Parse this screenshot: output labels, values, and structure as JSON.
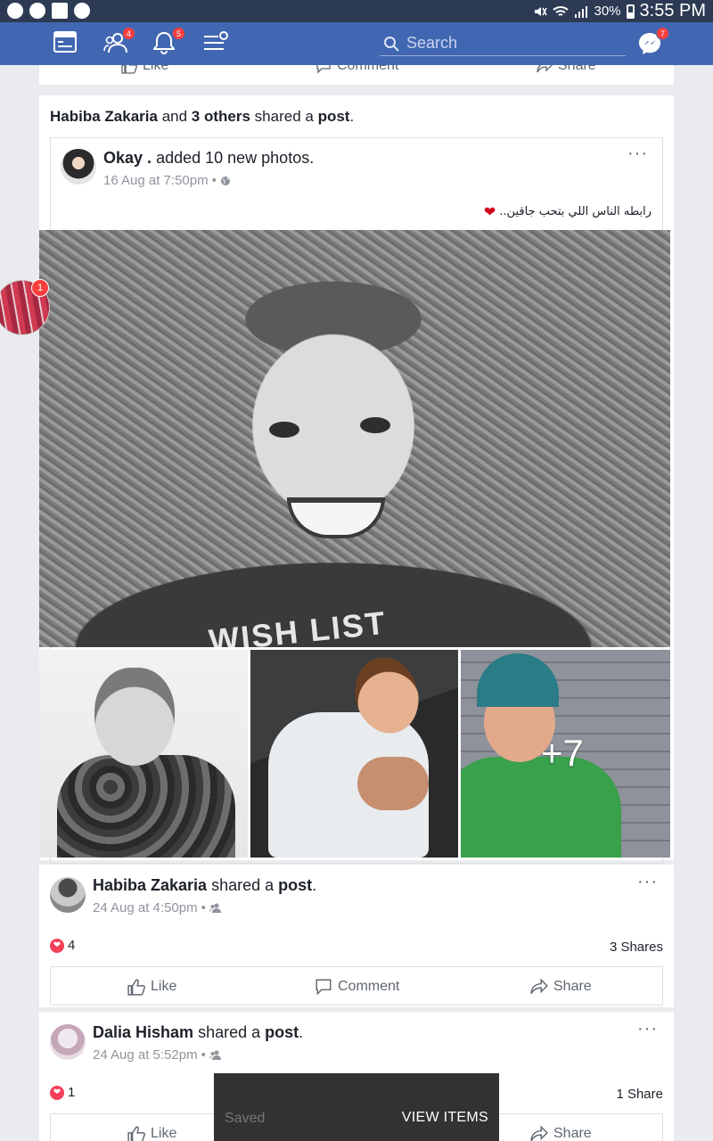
{
  "status": {
    "battery": "30%",
    "time": "3:55 PM"
  },
  "header": {
    "search_placeholder": "Search",
    "friend_requests_badge": "4",
    "notifications_badge": "5",
    "messenger_badge": "7"
  },
  "prev_post_actions": {
    "like": "Like",
    "comment": "Comment",
    "share": "Share"
  },
  "post1": {
    "headline": {
      "actor": "Habiba Zakaria",
      "and": "and",
      "others": "3 others",
      "verb": "shared a",
      "object": "post",
      "period": "."
    },
    "inner": {
      "author": "Okay .",
      "action": "added 10 new photos.",
      "time": "16 Aug at 7:50pm",
      "caption": "رابطه الناس اللي بتحب جاقين..",
      "main_photo_text": "WISH LIST",
      "more_photos": "+7"
    }
  },
  "post2": {
    "author": "Habiba Zakaria",
    "verb": "shared a",
    "object": "post",
    "period": ".",
    "time": "24 Aug at 4:50pm",
    "reactions": "4",
    "shares": "3 Shares",
    "actions": {
      "like": "Like",
      "comment": "Comment",
      "share": "Share"
    }
  },
  "post3": {
    "author": "Dalia Hisham",
    "verb": "shared a",
    "object": "post",
    "period": ".",
    "time": "24 Aug at 5:52pm",
    "reactions": "1",
    "shares": "1 Share",
    "actions": {
      "like": "Like",
      "share": "Share"
    }
  },
  "toast": {
    "message": "Saved",
    "action": "VIEW ITEMS"
  },
  "chathead": {
    "badge": "1"
  },
  "colors": {
    "brand": "#4267b2",
    "statusbar": "#2d3a54",
    "badge": "#fa3e3e",
    "love": "#f33e58"
  }
}
